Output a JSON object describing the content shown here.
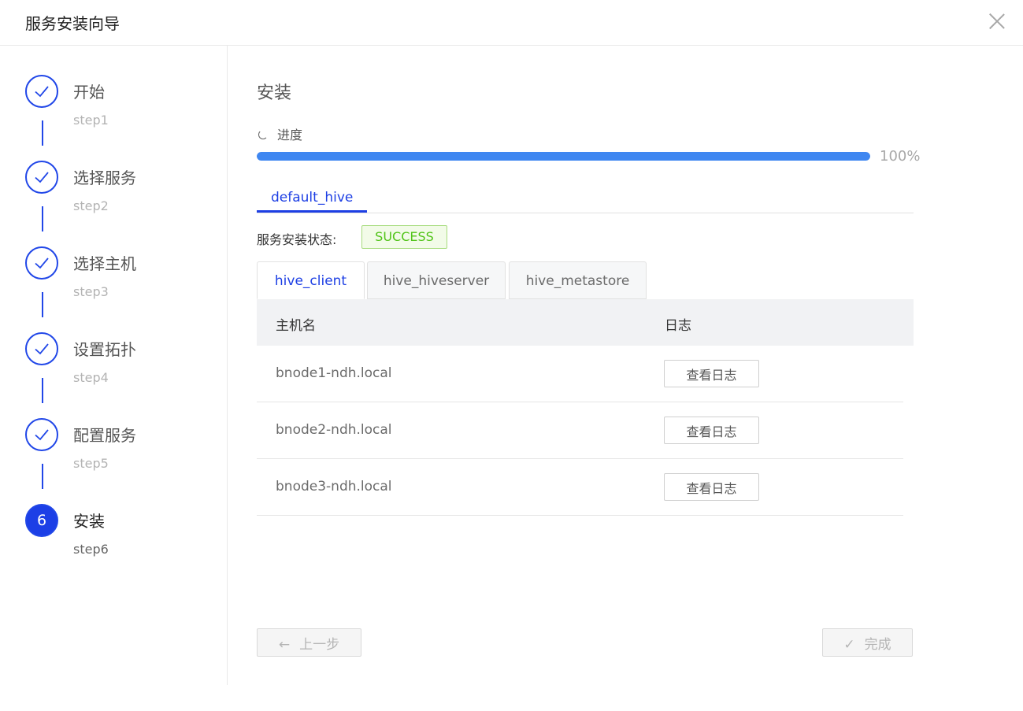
{
  "dialog": {
    "title": "服务安装向导"
  },
  "icons": {
    "close": "close-icon",
    "check": "check-icon",
    "spinner": "loading-icon",
    "arrow_left": "arrow-left-icon"
  },
  "colors": {
    "primary": "#1d3fe4",
    "progress": "#3f87f1",
    "success": "#52c41a"
  },
  "steps": [
    {
      "label": "开始",
      "sub": "step1",
      "state": "done"
    },
    {
      "label": "选择服务",
      "sub": "step2",
      "state": "done"
    },
    {
      "label": "选择主机",
      "sub": "step3",
      "state": "done"
    },
    {
      "label": "设置拓扑",
      "sub": "step4",
      "state": "done"
    },
    {
      "label": "配置服务",
      "sub": "step5",
      "state": "done"
    },
    {
      "label": "安装",
      "sub": "step6",
      "state": "active",
      "number": "6"
    }
  ],
  "main": {
    "title": "安装",
    "progress": {
      "label": "进度",
      "value": 100,
      "text": "100%"
    },
    "service_tab": "default_hive",
    "status": {
      "label": "服务安装状态:",
      "value": "SUCCESS"
    },
    "component_tabs": [
      {
        "label": "hive_client",
        "active": true
      },
      {
        "label": "hive_hiveserver",
        "active": false
      },
      {
        "label": "hive_metastore",
        "active": false
      }
    ],
    "table": {
      "headers": [
        "主机名",
        "日志"
      ],
      "rows": [
        {
          "host": "bnode1-ndh.local",
          "action": "查看日志"
        },
        {
          "host": "bnode2-ndh.local",
          "action": "查看日志"
        },
        {
          "host": "bnode3-ndh.local",
          "action": "查看日志"
        }
      ]
    }
  },
  "footer": {
    "prev": "上一步",
    "done": "完成"
  }
}
